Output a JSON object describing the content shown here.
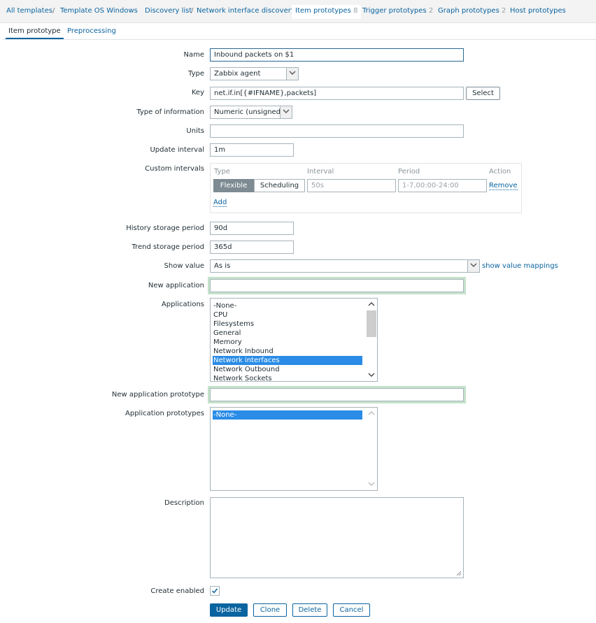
{
  "breadcrumbs": {
    "all_templates": "All templates",
    "template": "Template OS Windows",
    "discovery_list": "Discovery list",
    "rule": "Network interface discovery",
    "item_prototypes": "Item prototypes",
    "item_prototypes_count": "8",
    "trigger_prototypes": "Trigger prototypes",
    "trigger_prototypes_count": "2",
    "graph_prototypes": "Graph prototypes",
    "graph_prototypes_count": "2",
    "host_prototypes": "Host prototypes"
  },
  "tabs": {
    "item_prototype": "Item prototype",
    "preprocessing": "Preprocessing"
  },
  "form": {
    "name_label": "Name",
    "name_value": "Inbound packets on $1",
    "type_label": "Type",
    "type_value": "Zabbix agent",
    "key_label": "Key",
    "key_value": "net.if.in[{#IFNAME},packets]",
    "select_button": "Select",
    "type_info_label": "Type of information",
    "type_info_value": "Numeric (unsigned)",
    "units_label": "Units",
    "units_value": "",
    "update_interval_label": "Update interval",
    "update_interval_value": "1m",
    "custom_intervals_label": "Custom intervals",
    "custom_intervals": {
      "col_type": "Type",
      "col_interval": "Interval",
      "col_period": "Period",
      "col_action": "Action",
      "flexible": "Flexible",
      "scheduling": "Scheduling",
      "interval_placeholder": "50s",
      "period_placeholder": "1-7,00:00-24:00",
      "remove": "Remove",
      "add": "Add"
    },
    "history_label": "History storage period",
    "history_value": "90d",
    "trend_label": "Trend storage period",
    "trend_value": "365d",
    "show_value_label": "Show value",
    "show_value_value": "As is",
    "show_value_mappings": "show value mappings",
    "new_application_label": "New application",
    "new_application_value": "",
    "applications_label": "Applications",
    "applications": [
      "-None-",
      "CPU",
      "Filesystems",
      "General",
      "Memory",
      "Network Inbound",
      "Network interfaces",
      "Network Outbound",
      "Network Sockets"
    ],
    "applications_selected": "Network interfaces",
    "new_app_prototype_label": "New application prototype",
    "new_app_prototype_value": "",
    "app_prototypes_label": "Application prototypes",
    "app_prototypes": [
      "-None-"
    ],
    "description_label": "Description",
    "description_value": "",
    "create_enabled_label": "Create enabled",
    "create_enabled": true
  },
  "buttons": {
    "update": "Update",
    "clone": "Clone",
    "delete": "Delete",
    "cancel": "Cancel"
  },
  "colors": {
    "link": "#0a64a0",
    "selection": "#2a8ce6",
    "focus_glow": "#c5e2cc"
  }
}
